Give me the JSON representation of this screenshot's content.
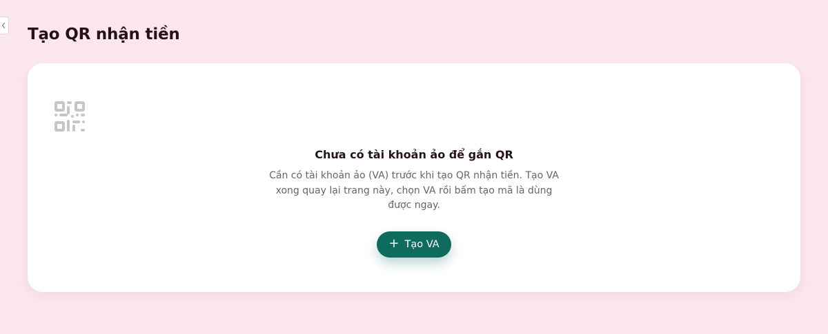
{
  "page": {
    "title": "Tạo QR nhận tiền"
  },
  "sidebar_toggle": {
    "icon": "chevron-left-icon"
  },
  "empty_state": {
    "icon": "qr-code-icon",
    "title": "Chưa có tài khoản ảo để gắn QR",
    "description": "Cần có tài khoản ảo (VA) trước khi tạo QR nhận tiền. Tạo VA xong quay lại trang này, chọn VA rồi bấm tạo mã là dùng được ngay.",
    "button": {
      "icon": "plus-icon",
      "icon_glyph": "+",
      "label": "Tạo VA"
    }
  },
  "colors": {
    "background": "#fbe7ec",
    "card": "#ffffff",
    "accent": "#0e6b5e",
    "title_text": "#241417",
    "body_text": "#6e6166",
    "icon_gray": "#c9c4c6"
  }
}
